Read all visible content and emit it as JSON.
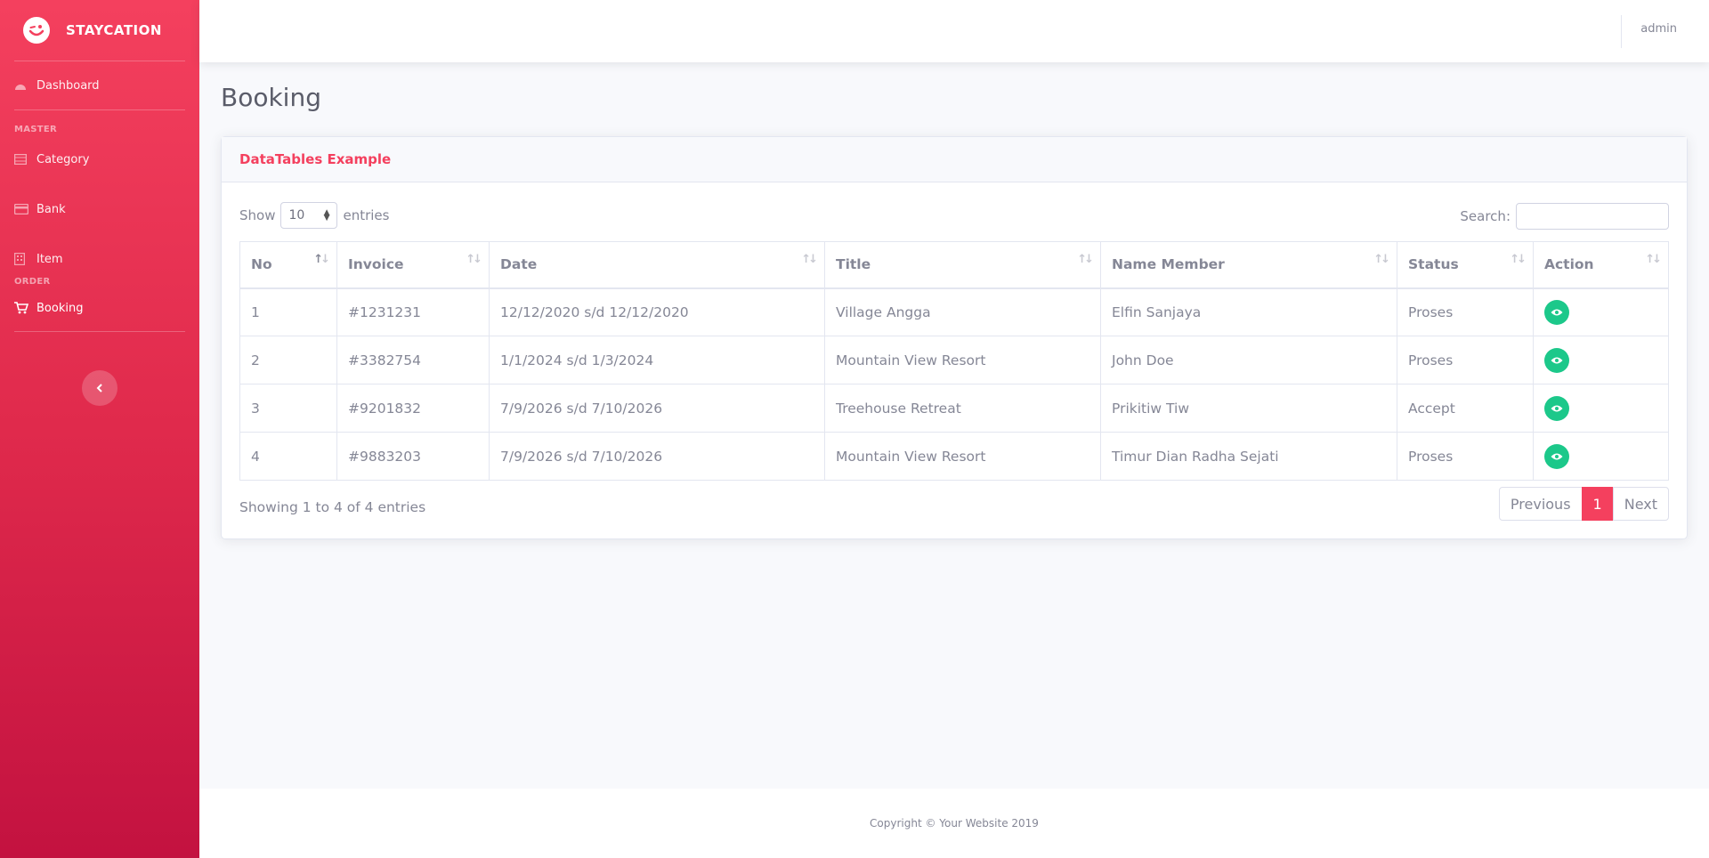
{
  "brand": {
    "name": "STAYCATION"
  },
  "sidebar": {
    "dashboard": "Dashboard",
    "heading_master": "MASTER",
    "category": "Category",
    "bank": "Bank",
    "item": "Item",
    "heading_order": "ORDER",
    "booking": "Booking"
  },
  "topbar": {
    "user": "admin"
  },
  "page": {
    "title": "Booking"
  },
  "card": {
    "title": "DataTables Example"
  },
  "controls": {
    "show_label": "Show",
    "entries_value": "10",
    "entries_label": "entries",
    "search_label": "Search:",
    "search_value": ""
  },
  "table": {
    "columns": [
      "No",
      "Invoice",
      "Date",
      "Title",
      "Name Member",
      "Status",
      "Action"
    ],
    "rows": [
      {
        "no": "1",
        "invoice": "#1231231",
        "date": "12/12/2020 s/d 12/12/2020",
        "title": "Village Angga",
        "member": "Elfin Sanjaya",
        "status": "Proses"
      },
      {
        "no": "2",
        "invoice": "#3382754",
        "date": "1/1/2024 s/d 1/3/2024",
        "title": "Mountain View Resort",
        "member": "John Doe",
        "status": "Proses"
      },
      {
        "no": "3",
        "invoice": "#9201832",
        "date": "7/9/2026 s/d 7/10/2026",
        "title": "Treehouse Retreat",
        "member": "Prikitiw Tiw",
        "status": "Accept"
      },
      {
        "no": "4",
        "invoice": "#9883203",
        "date": "7/9/2026 s/d 7/10/2026",
        "title": "Mountain View Resort",
        "member": "Timur Dian Radha Sejati",
        "status": "Proses"
      }
    ]
  },
  "info": "Showing 1 to 4 of 4 entries",
  "pagination": {
    "previous": "Previous",
    "current": "1",
    "next": "Next"
  },
  "footer": "Copyright © Your Website 2019",
  "colors": {
    "brand": "#f4405e",
    "success": "#1cc88a"
  }
}
